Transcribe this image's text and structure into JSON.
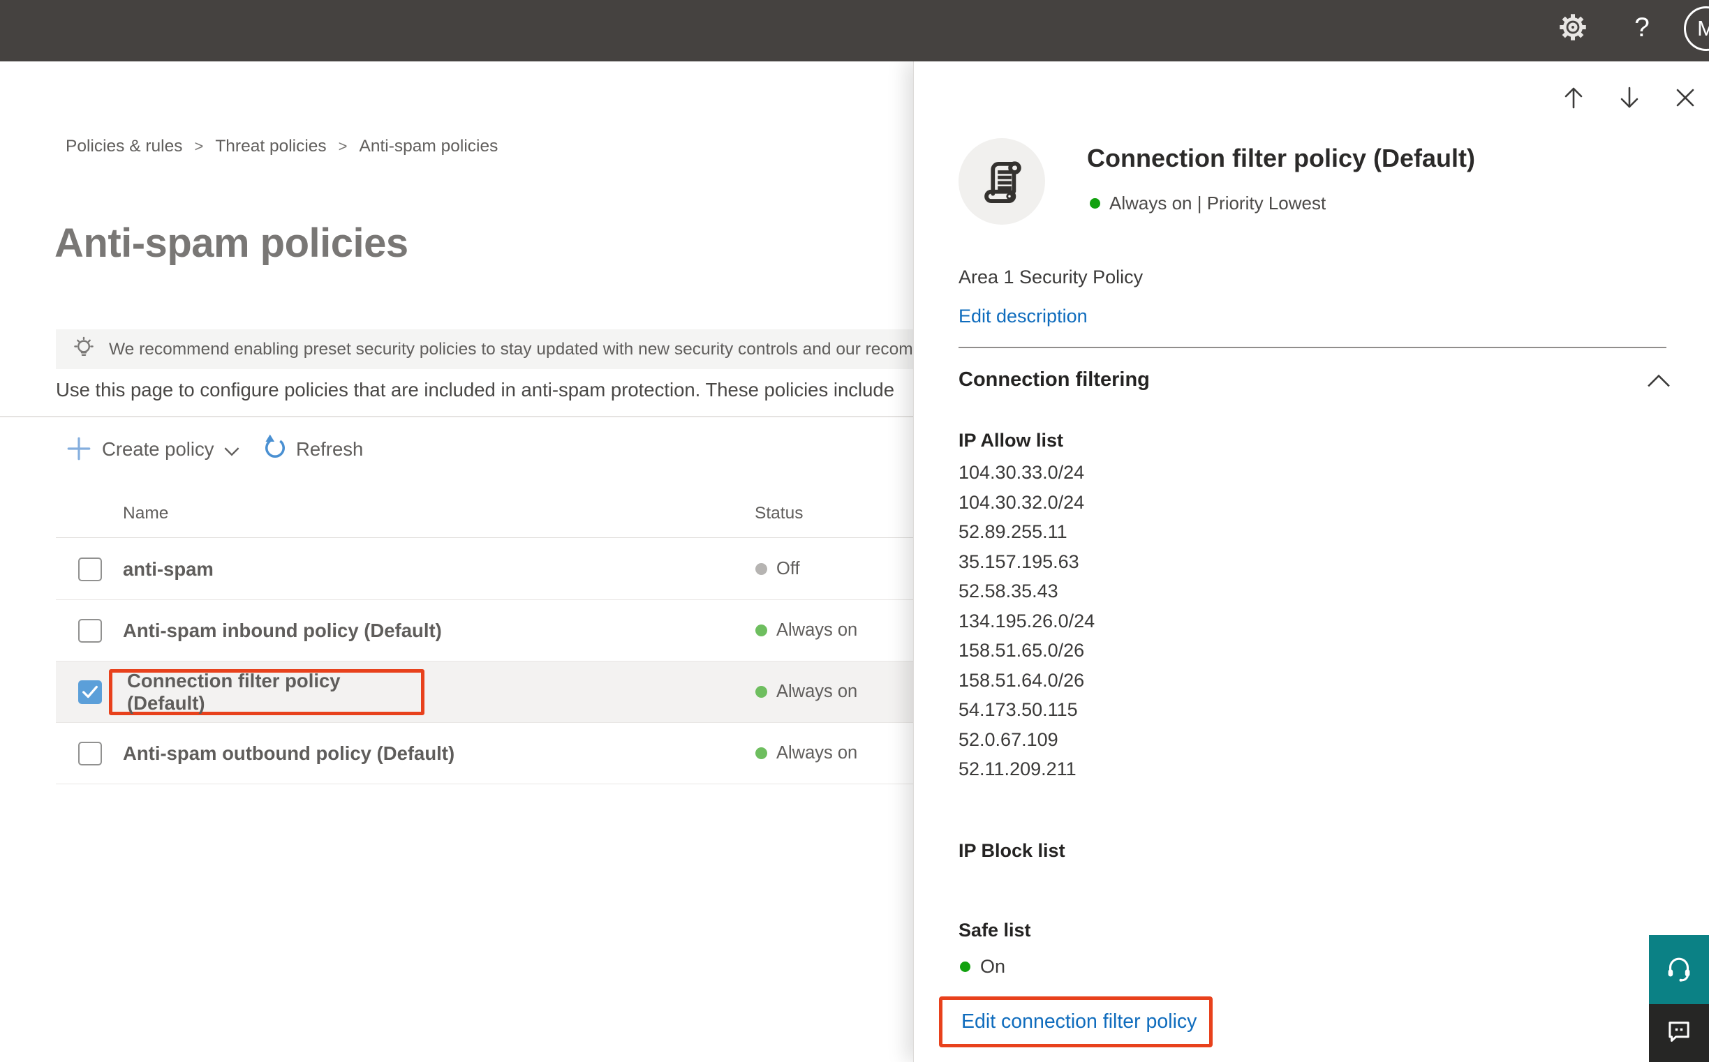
{
  "topbar": {
    "avatar_initial": "M",
    "help_label": "?"
  },
  "breadcrumb": {
    "separator": ">",
    "items": [
      {
        "label": "Policies & rules"
      },
      {
        "label": "Threat policies"
      },
      {
        "label": "Anti-spam policies"
      }
    ]
  },
  "page": {
    "title": "Anti-spam policies",
    "banner_text": "We recommend enabling preset security policies to stay updated with new security controls and our recomme",
    "intro_text": "Use this page to configure policies that are included in anti-spam protection. These policies include",
    "toolbar": {
      "create_policy_label": "Create policy",
      "refresh_label": "Refresh"
    },
    "table": {
      "columns": {
        "name": "Name",
        "status": "Status"
      },
      "rows": [
        {
          "name": "anti-spam",
          "status": "Off",
          "checked": false
        },
        {
          "name": "Anti-spam inbound policy (Default)",
          "status": "Always on",
          "checked": false
        },
        {
          "name": "Connection filter policy (Default)",
          "status": "Always on",
          "checked": true
        },
        {
          "name": "Anti-spam outbound policy (Default)",
          "status": "Always on",
          "checked": false
        }
      ]
    }
  },
  "flyout": {
    "title": "Connection filter policy (Default)",
    "status_text": "Always on | Priority Lowest",
    "description": "Area 1 Security Policy",
    "edit_description_label": "Edit description",
    "section_title": "Connection filtering",
    "ip_allow_label": "IP Allow list",
    "ip_allow_items": [
      "104.30.33.0/24",
      "104.30.32.0/24",
      "52.89.255.11",
      "35.157.195.63",
      "52.58.35.43",
      "134.195.26.0/24",
      "158.51.65.0/26",
      "158.51.64.0/26",
      "54.173.50.115",
      "52.0.67.109",
      "52.11.209.211"
    ],
    "ip_block_label": "IP Block list",
    "safe_list_label": "Safe list",
    "safe_list_status": "On",
    "edit_policy_label": "Edit connection filter policy"
  },
  "colors": {
    "topbar_bg": "#454240",
    "accent_link": "#0f6cbd",
    "highlight_red": "#e8411c",
    "status_on_green": "#6ebe5f",
    "status_bright_green": "#11a10e",
    "status_off_gray": "#b6b4b2",
    "checkbox_checked_blue": "#5b9fd9",
    "support_teal": "#0b8185",
    "feedback_dark": "#262625",
    "row_highlight": "#f3f2f1"
  }
}
